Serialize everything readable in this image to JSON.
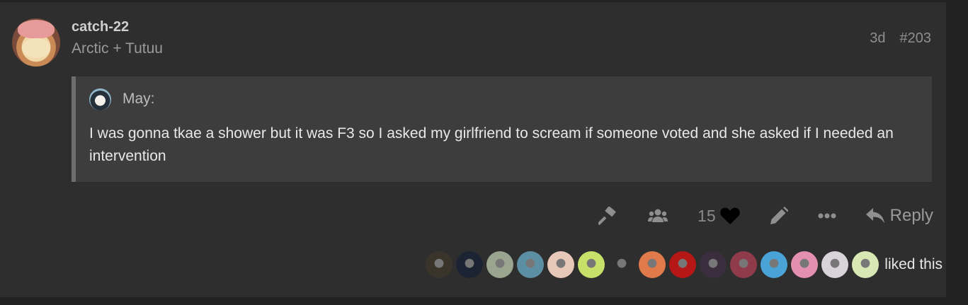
{
  "post": {
    "username": "catch-22",
    "user_title": "Arctic + Tutuu",
    "age": "3d",
    "post_number": "#203",
    "quote": {
      "author": "May:",
      "text": "I was gonna tkae a shower but it was F3 so I asked my girlfriend to scream if someone voted and she asked if I needed an intervention"
    },
    "actions": {
      "like_count": "15",
      "reply_label": "Reply",
      "icons": [
        "gavel-icon",
        "users-icon",
        "heart-icon",
        "pencil-icon",
        "ellipsis-icon",
        "reply-icon"
      ]
    },
    "likers": {
      "count_shown": 15,
      "label": "liked this",
      "colors": [
        "#3b342b",
        "#1c2433",
        "#9aa58f",
        "#5c8fa3",
        "#e7c7b7",
        "#c7e06a",
        "#2e2e2e",
        "#e07a4a",
        "#b51616",
        "#3a2e3e",
        "#8f3b4a",
        "#4aa3d6",
        "#e38fb0",
        "#d9d3da",
        "#d8e8b4"
      ]
    }
  }
}
